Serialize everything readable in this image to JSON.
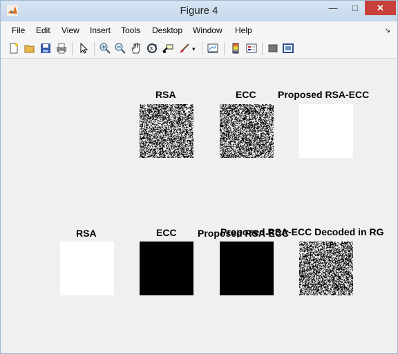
{
  "window": {
    "title": "Figure 4",
    "minimize_glyph": "—",
    "maximize_glyph": "□",
    "close_glyph": "✕"
  },
  "menubar": {
    "items": [
      "File",
      "Edit",
      "View",
      "Insert",
      "Tools",
      "Desktop",
      "Window",
      "Help"
    ],
    "overflow_arrow": "↘"
  },
  "toolbar": {
    "buttons": [
      {
        "icon": "new-figure-icon"
      },
      {
        "icon": "open-file-icon"
      },
      {
        "icon": "save-figure-icon"
      },
      {
        "icon": "print-figure-icon"
      },
      {
        "icon": "edit-plot-icon"
      },
      {
        "icon": "zoom-in-icon"
      },
      {
        "icon": "zoom-out-icon"
      },
      {
        "icon": "pan-icon"
      },
      {
        "icon": "rotate-3d-icon"
      },
      {
        "icon": "data-cursor-icon"
      },
      {
        "icon": "brush-icon"
      },
      {
        "icon": "link-plot-icon"
      },
      {
        "icon": "insert-colorbar-icon"
      },
      {
        "icon": "insert-legend-icon"
      },
      {
        "icon": "hide-plot-tools-icon"
      },
      {
        "icon": "show-plot-tools-icon"
      }
    ]
  },
  "figure": {
    "top_row": [
      {
        "title": "RSA",
        "image": "noise"
      },
      {
        "title": "ECC",
        "image": "noise"
      },
      {
        "title": "Proposed RSA-ECC",
        "image": "white"
      }
    ],
    "bottom_row": [
      {
        "title": "RSA",
        "image": "white"
      },
      {
        "title": "ECC",
        "image": "black"
      },
      {
        "title": "Proposed RSA-ECC",
        "image": "black"
      },
      {
        "title": "Proposed RSA-ECC Decoded in RG",
        "image": "noise"
      }
    ]
  }
}
